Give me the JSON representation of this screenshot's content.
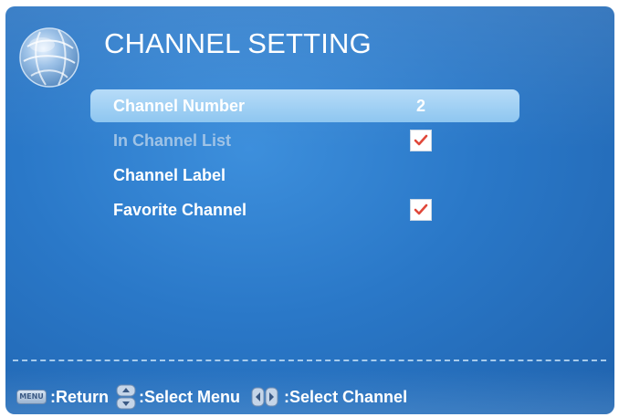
{
  "header": {
    "title": "CHANNEL SETTING",
    "icon": "globe-icon"
  },
  "menu": {
    "items": [
      {
        "label": "Channel Number",
        "value": "2",
        "state": "selected"
      },
      {
        "label": "In Channel List",
        "checked": true,
        "state": "disabled"
      },
      {
        "label": "Channel Label",
        "state": "normal"
      },
      {
        "label": "Favorite Channel",
        "checked": true,
        "state": "normal"
      }
    ]
  },
  "footer": {
    "menu_key_label": "MENU",
    "return_hint": ":Return",
    "select_menu_hint": ":Select Menu",
    "select_channel_hint": ":Select Channel"
  },
  "colors": {
    "background": "#2a78c8",
    "highlight": "#a4d2f4",
    "text": "#ffffff",
    "disabled_text": "#9fc3e6",
    "checkmark": "#e0483a"
  }
}
